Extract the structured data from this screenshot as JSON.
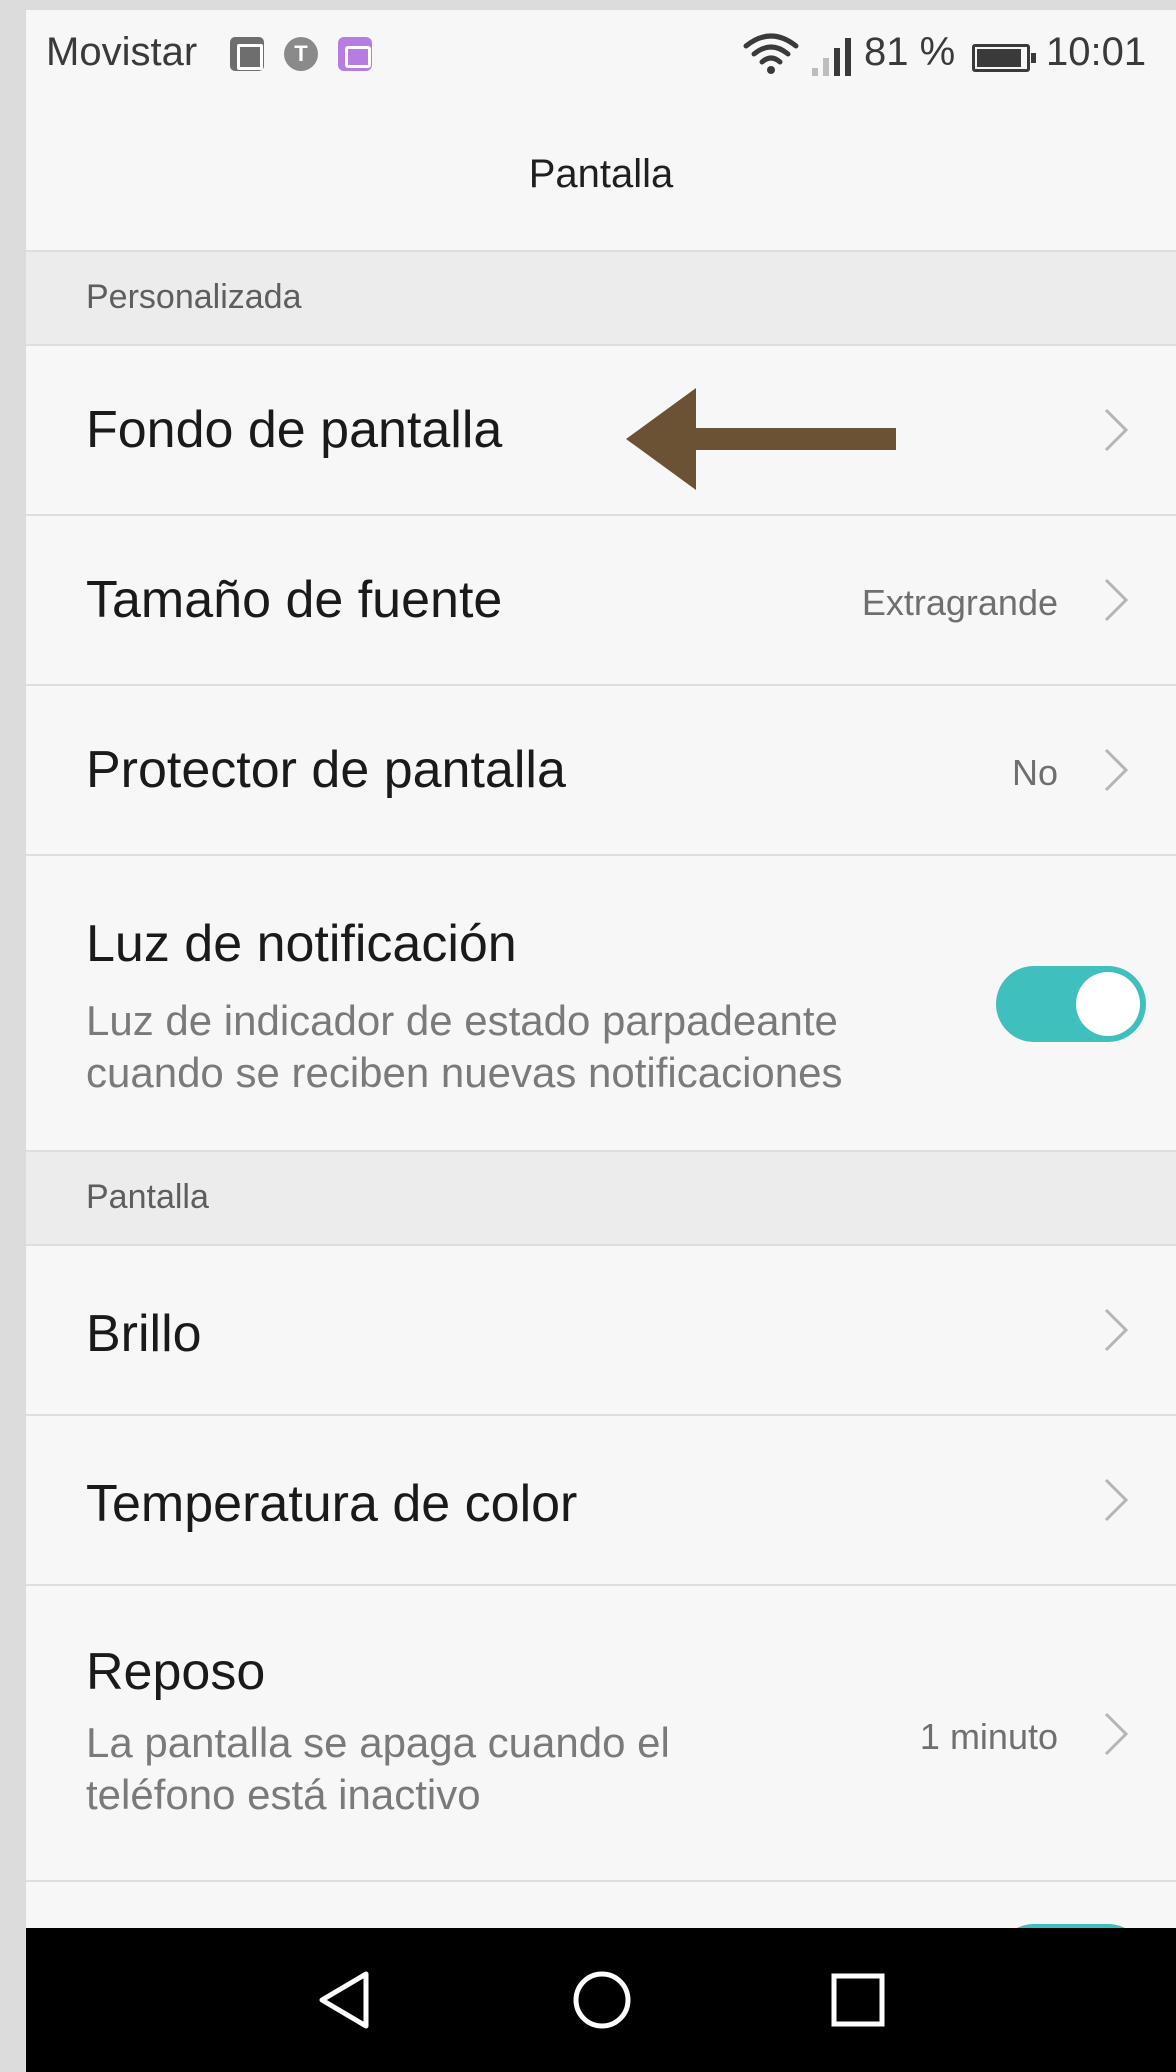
{
  "status_bar": {
    "carrier": "Movistar",
    "notification_icons": [
      "gallery-icon",
      "t-icon",
      "chat-icon"
    ],
    "t_icon_letter": "T",
    "battery_percent": "81 %",
    "time": "10:01"
  },
  "header": {
    "title": "Pantalla"
  },
  "sections": [
    {
      "header": "Personalizada"
    },
    {
      "header": "Pantalla"
    }
  ],
  "rows": {
    "fondo": {
      "title": "Fondo de pantalla"
    },
    "tamano": {
      "title": "Tamaño de fuente",
      "value": "Extragrande"
    },
    "protector": {
      "title": "Protector de pantalla",
      "value": "No"
    },
    "luz": {
      "title": "Luz de notificación",
      "subtitle_line1": "Luz de indicador de estado parpadeante",
      "subtitle_line2": "cuando se reciben nuevas notificaciones",
      "enabled": true
    },
    "brillo": {
      "title": "Brillo"
    },
    "temperatura": {
      "title": "Temperatura de color"
    },
    "reposo": {
      "title": "Reposo",
      "subtitle_line1": "La pantalla se apaga cuando el",
      "subtitle_line2": "teléfono está inactivo",
      "value": "1 minuto"
    },
    "partial_next": {
      "enabled": true
    }
  },
  "annotation": {
    "arrow_color": "#6b5234"
  },
  "colors": {
    "toggle_on": "#3fbfbe",
    "background": "#f7f7f7",
    "section_bg": "#ececec"
  },
  "nav_bar": {
    "buttons": [
      "back-icon",
      "home-icon",
      "recents-icon"
    ]
  }
}
